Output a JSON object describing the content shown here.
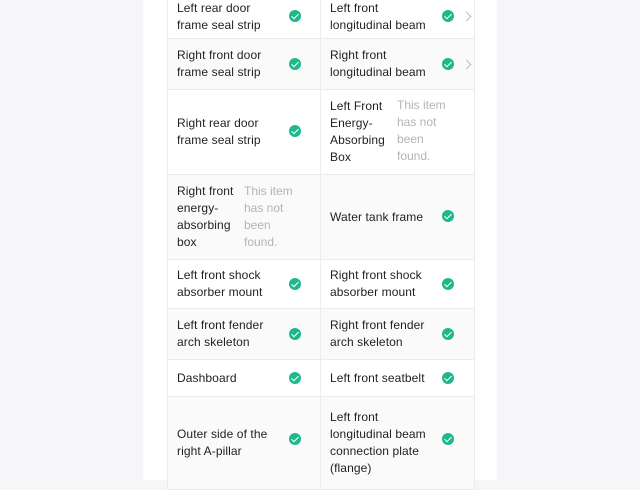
{
  "inspection_items": {
    "not_found_text": "This item has not been found.",
    "rows": [
      {
        "left": "Left rear door frame seal strip",
        "right": "Left front longitudinal beam"
      },
      {
        "left": "Right front door frame seal strip",
        "right": "Right front longitudinal beam"
      },
      {
        "left": "Right rear door frame seal strip",
        "right": "Left Front Energy-Absorbing Box"
      },
      {
        "left": "Right front energy-absorbing box",
        "right": "Water tank frame"
      },
      {
        "left": "Left front shock absorber mount",
        "right": "Right front shock absorber mount"
      },
      {
        "left": "Left front fender arch skeleton",
        "right": "Right front fender arch skeleton"
      },
      {
        "left": "Dashboard",
        "right": "Left front seatbelt"
      },
      {
        "left": "Outer side of the right A-pillar",
        "right": "Left front longitudinal beam connection plate (flange)"
      }
    ]
  },
  "colors": {
    "check_green": "#1db88c",
    "not_found_gray": "#b4b4b4"
  },
  "icons": {
    "status_ok": "check-circle-icon",
    "expand": "chevron-right-icon"
  }
}
